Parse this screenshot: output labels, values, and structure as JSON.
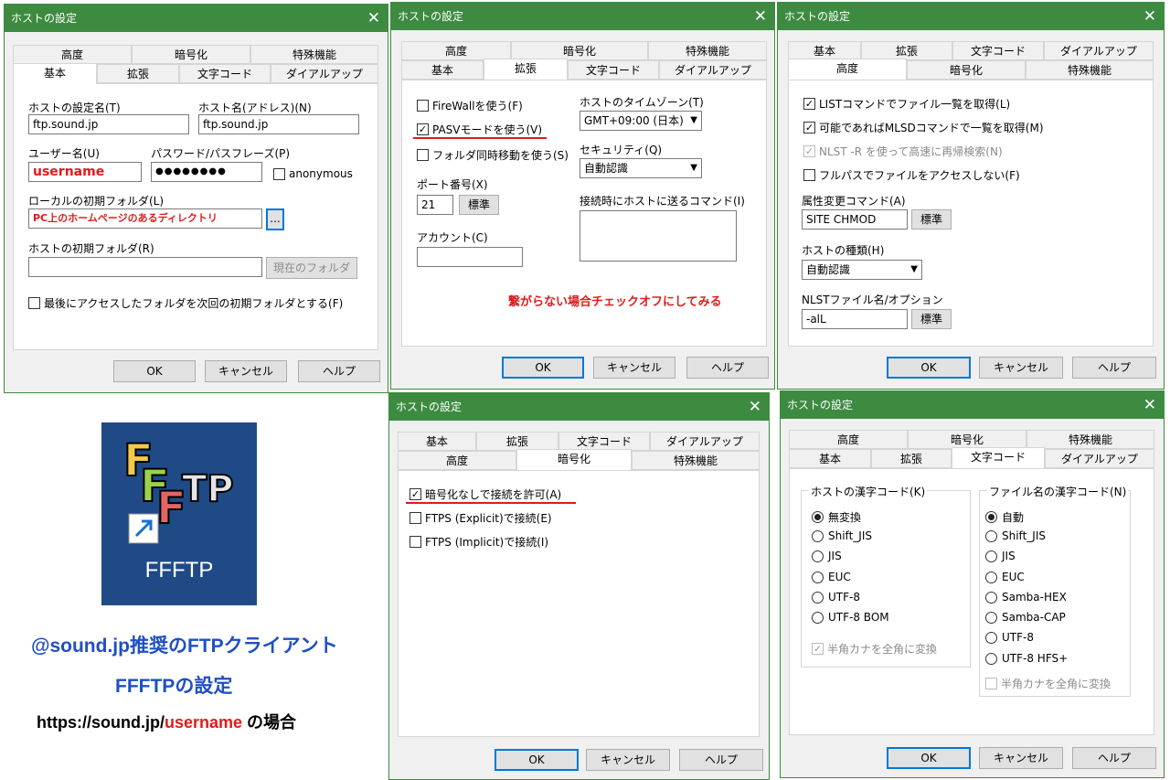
{
  "title": "ホストの設定",
  "close": "✕",
  "buttons": {
    "ok": "OK",
    "cancel": "キャンセル",
    "help": "ヘルプ"
  },
  "tabs": {
    "basic": "基本",
    "ext": "拡張",
    "charcode": "文字コード",
    "dialup": "ダイアルアップ",
    "advanced": "高度",
    "crypto": "暗号化",
    "special": "特殊機能"
  },
  "d1": {
    "host_name_label": "ホストの設定名(T)",
    "host_name_value": "ftp.sound.jp",
    "host_addr_label": "ホスト名(アドレス)(N)",
    "host_addr_value": "ftp.sound.jp",
    "user_label": "ユーザー名(U)",
    "user_value": "username",
    "pass_label": "パスワード/パスフレーズ(P)",
    "pass_value": "●●●●●●●●",
    "anon_label": "anonymous",
    "local_label": "ローカルの初期フォルダ(L)",
    "local_value": "PC上のホームページのあるディレクトリ",
    "browse": "...",
    "remote_label": "ホストの初期フォルダ(R)",
    "remote_value": "",
    "current_folder": "現在のフォルダ",
    "last_folder": "最後にアクセスしたフォルダを次回の初期フォルダとする(F)"
  },
  "d2": {
    "firewall": "FireWallを使う(F)",
    "pasv": "PASVモードを使う(V)",
    "sync": "フォルダ同時移動を使う(S)",
    "port_label": "ポート番号(X)",
    "port_value": "21",
    "std": "標準",
    "account_label": "アカウント(C)",
    "tz_label": "ホストのタイムゾーン(T)",
    "tz_value": "GMT+09:00 (日本)",
    "sec_label": "セキュリティ(Q)",
    "sec_value": "自動認識",
    "cmd_label": "接続時にホストに送るコマンド(I)",
    "note": "繋がらない場合チェックオフにしてみる"
  },
  "d3": {
    "list": "LISTコマンドでファイル一覧を取得(L)",
    "mlsd": "可能であればMLSDコマンドで一覧を取得(M)",
    "nlst": "NLST -R を使って高速に再帰検索(N)",
    "fullpath": "フルパスでファイルをアクセスしない(F)",
    "attr_label": "属性変更コマンド(A)",
    "attr_value": "SITE CHMOD",
    "hosttype_label": "ホストの種類(H)",
    "hosttype_value": "自動認識",
    "nlstfile_label": "NLSTファイル名/オプション",
    "nlstfile_value": "-alL",
    "std": "標準"
  },
  "d4": {
    "allow": "暗号化なしで接続を許可(A)",
    "explicit": "FTPS (Explicit)で接続(E)",
    "implicit": "FTPS (Implicit)で接続(I)"
  },
  "d5": {
    "host_kanji": "ホストの漢字コード(K)",
    "host_opts": [
      "無変換",
      "Shift_JIS",
      "JIS",
      "EUC",
      "UTF-8",
      "UTF-8 BOM"
    ],
    "file_kanji": "ファイル名の漢字コード(N)",
    "file_opts": [
      "自動",
      "Shift_JIS",
      "JIS",
      "EUC",
      "Samba-HEX",
      "Samba-CAP",
      "UTF-8",
      "UTF-8 HFS+"
    ],
    "kana": "半角カナを全角に変換"
  },
  "promo": {
    "icon_letters": "FFFTP",
    "icon_label": "FFFTP",
    "line1": "@sound.jp推奨のFTPクライアント",
    "line2": "FFFTPの設定",
    "url_prefix": "https://sound.jp/",
    "url_user": "username",
    "url_suffix": " の場合"
  },
  "colors": {
    "titlebar": "#3d8b40",
    "accent_red": "#e01b1b",
    "promo_blue": "#1f4fc4",
    "icon_bg": "#1f4a86"
  }
}
